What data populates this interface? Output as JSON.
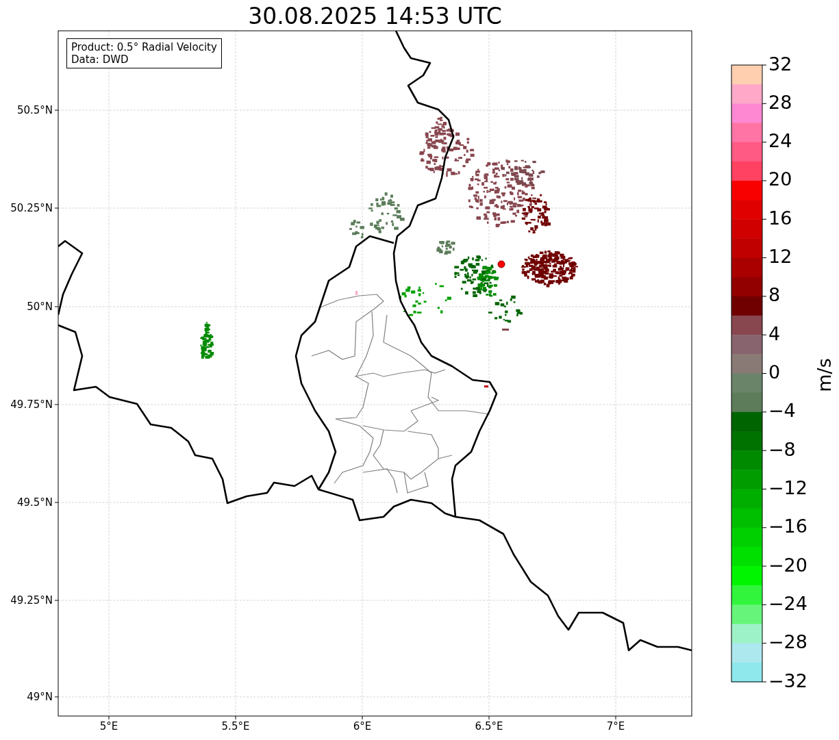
{
  "title": "30.08.2025 14:53 UTC",
  "info_box": {
    "lines": [
      "Product: 0.5° Radial Velocity",
      "Data: DWD"
    ]
  },
  "map": {
    "x_ticks": [
      "5°E",
      "5.5°E",
      "6°E",
      "6.5°E",
      "7°E"
    ],
    "y_ticks": [
      "50.5°N",
      "50.25°N",
      "50°N",
      "49.75°N",
      "49.5°N",
      "49.25°N",
      "49°N"
    ]
  },
  "colorbar": {
    "label": "m/s",
    "ticks": [
      "32",
      "28",
      "24",
      "20",
      "16",
      "12",
      "8",
      "4",
      "0",
      "−4",
      "−8",
      "−12",
      "−16",
      "−20",
      "−24",
      "−28",
      "−32"
    ],
    "bins": [
      {
        "color": "#ffcfb0"
      },
      {
        "color": "#ffa8c8"
      },
      {
        "color": "#ff88d2"
      },
      {
        "color": "#ff74a4"
      },
      {
        "color": "#ff5a84"
      },
      {
        "color": "#ff4262"
      },
      {
        "color": "#f80000"
      },
      {
        "color": "#e00000"
      },
      {
        "color": "#d00000"
      },
      {
        "color": "#c00000"
      },
      {
        "color": "#aa0000"
      },
      {
        "color": "#920000"
      },
      {
        "color": "#700000"
      },
      {
        "color": "#88464e"
      },
      {
        "color": "#88646e"
      },
      {
        "color": "#8a7a76"
      },
      {
        "color": "#6a846a"
      },
      {
        "color": "#5c7c5a"
      },
      {
        "color": "#006400"
      },
      {
        "color": "#007200"
      },
      {
        "color": "#008a00"
      },
      {
        "color": "#009c00"
      },
      {
        "color": "#00ae00"
      },
      {
        "color": "#00be00"
      },
      {
        "color": "#00d000"
      },
      {
        "color": "#00e000"
      },
      {
        "color": "#00f500"
      },
      {
        "color": "#30f53c"
      },
      {
        "color": "#66f57a"
      },
      {
        "color": "#9ef2c8"
      },
      {
        "color": "#ace8ee"
      },
      {
        "color": "#8ee8ec"
      }
    ]
  }
}
